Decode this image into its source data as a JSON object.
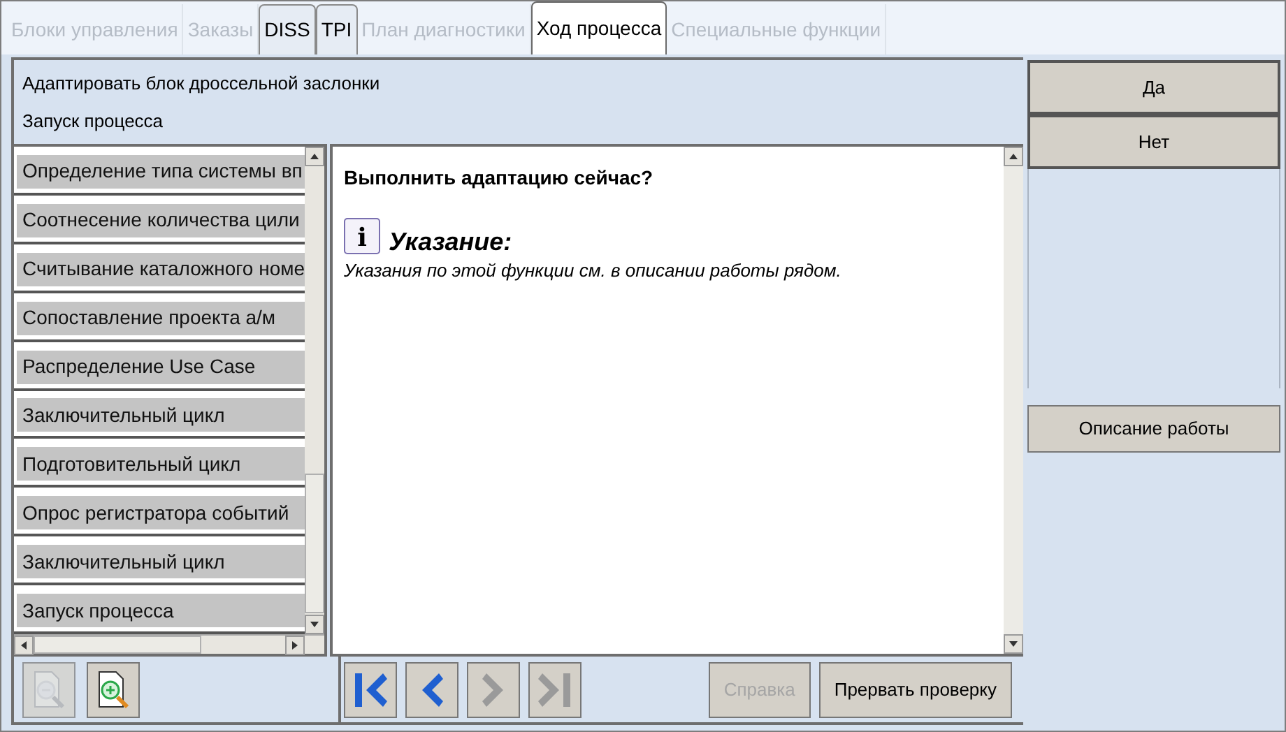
{
  "tabs": [
    {
      "label": "Блоки управления",
      "selected": false,
      "disabled": true
    },
    {
      "label": "Заказы",
      "selected": false,
      "disabled": true
    },
    {
      "label": "DISS",
      "selected": false,
      "disabled": false
    },
    {
      "label": "TPI",
      "selected": false,
      "disabled": false
    },
    {
      "label": "План диагностики",
      "selected": false,
      "disabled": true
    },
    {
      "label": "Ход процесса",
      "selected": true,
      "disabled": false
    },
    {
      "label": "Специальные функции",
      "selected": false,
      "disabled": true
    }
  ],
  "header": {
    "title": "Адаптировать блок дроссельной заслонки",
    "step": "Запуск процесса"
  },
  "steps": [
    {
      "label": "Определение типа системы вп"
    },
    {
      "label": "Соотнесение количества цили"
    },
    {
      "label": "Считывание каталожного номе"
    },
    {
      "label": "Сопоставление проекта а/м"
    },
    {
      "label": "Распределение Use Case"
    },
    {
      "label": "Заключительный цикл"
    },
    {
      "label": "Подготовительный цикл"
    },
    {
      "label": "Опрос регистратора событий"
    },
    {
      "label": "Заключительный цикл"
    },
    {
      "label": "Запуск процесса"
    }
  ],
  "content": {
    "question": "Выполнить адаптацию сейчас?",
    "note_icon": "i",
    "note_title": "Указание:",
    "note_text": "Указания по этой функции см. в описании работы рядом."
  },
  "zoom_buttons": [
    {
      "kind": "zoom_out",
      "disabled": true
    },
    {
      "kind": "zoom_in",
      "disabled": false
    }
  ],
  "nav_buttons": [
    {
      "kind": "first",
      "disabled": false
    },
    {
      "kind": "prev",
      "disabled": false
    },
    {
      "kind": "next",
      "disabled": true
    },
    {
      "kind": "last",
      "disabled": true
    }
  ],
  "footer_buttons": [
    {
      "label": "Справка",
      "disabled": true
    },
    {
      "label": "Прервать проверку",
      "disabled": false
    }
  ],
  "side_buttons": [
    {
      "label": "Да"
    },
    {
      "label": "Нет"
    }
  ],
  "side_extra_buttons": [
    {
      "label": "Описание работы"
    }
  ]
}
